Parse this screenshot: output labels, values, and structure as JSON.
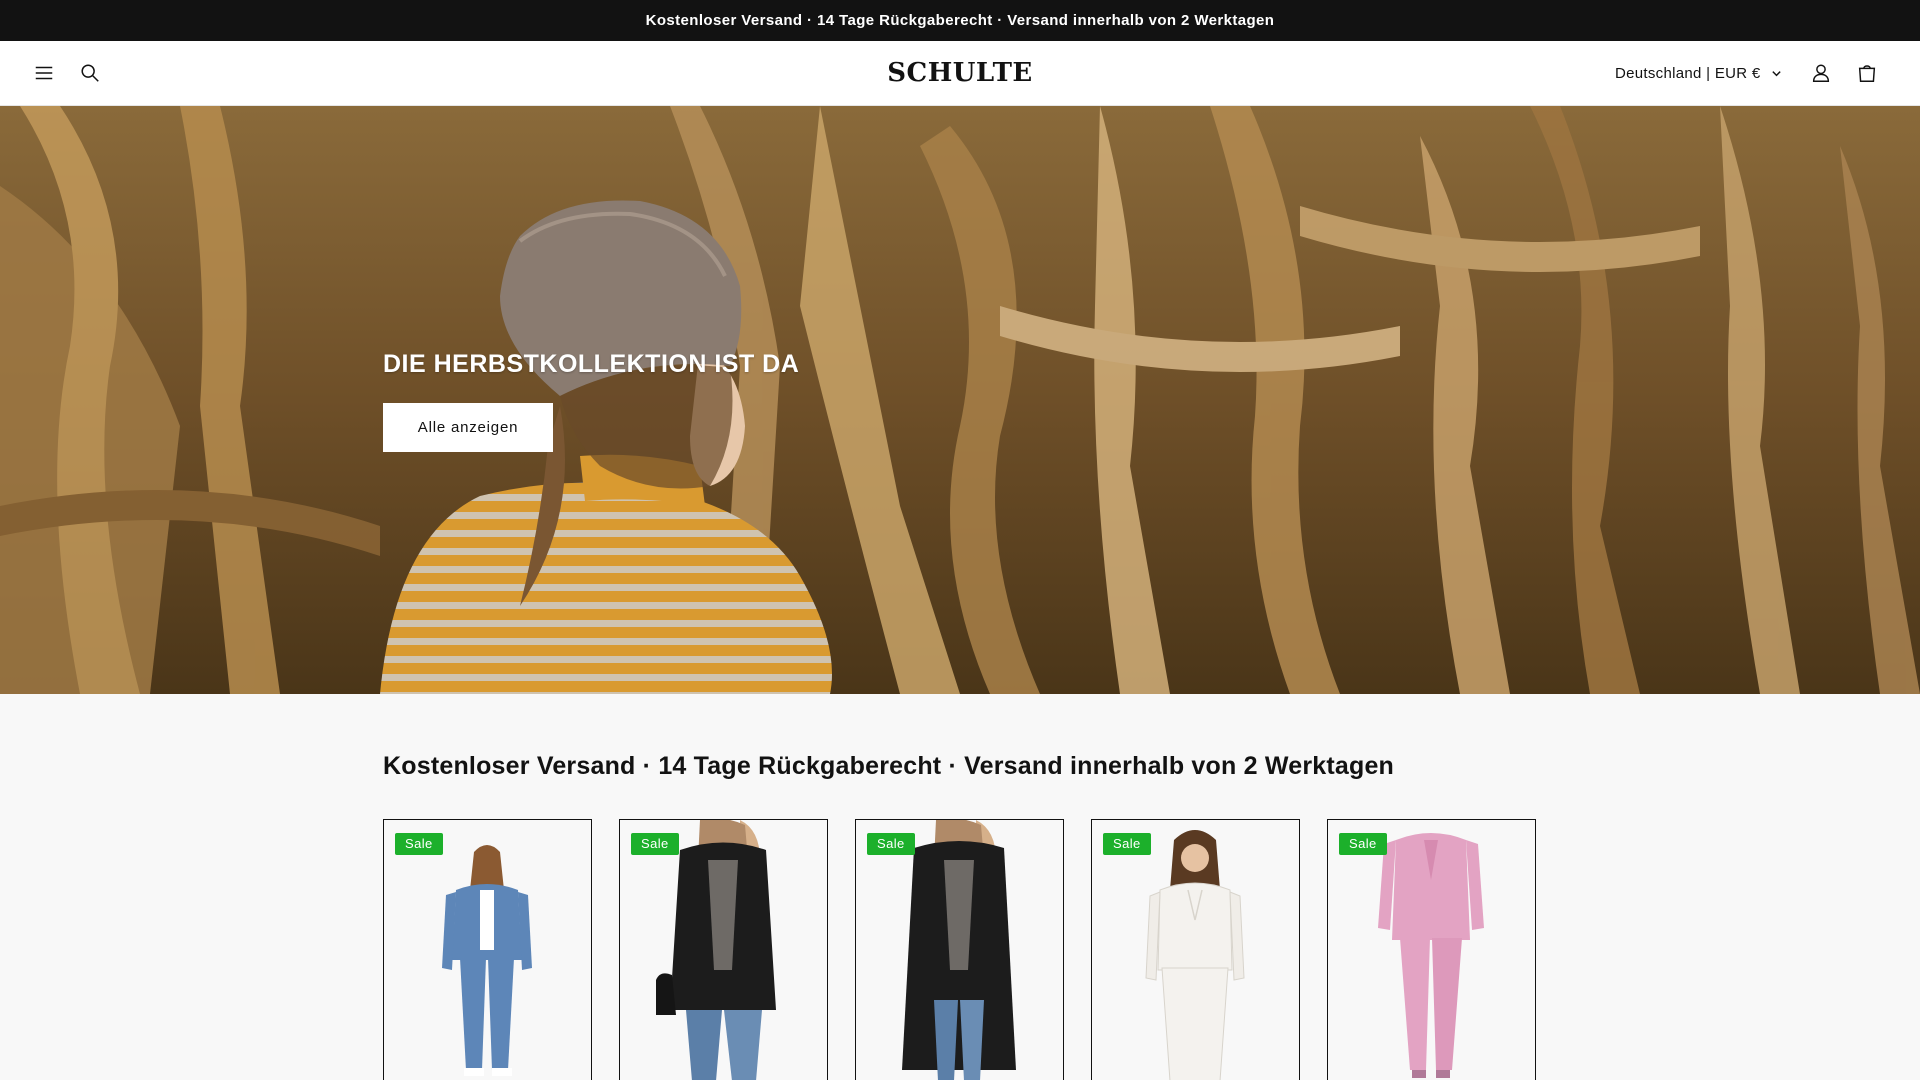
{
  "announcement": {
    "text": "Kostenloser Versand · 14 Tage Rückgaberecht · Versand innerhalb von 2 Werktagen"
  },
  "header": {
    "logo": "SCHULTE",
    "locale": "Deutschland | EUR €",
    "icons": [
      "menu-icon",
      "search-icon",
      "chevron-down-icon",
      "account-icon",
      "cart-icon"
    ]
  },
  "hero": {
    "title": "DIE HERBSTKOLLEKTION IST DA",
    "button_label": "Alle anzeigen"
  },
  "collection": {
    "heading": "Kostenloser Versand · 14 Tage Rückgaberecht · Versand innerhalb von 2 Werktagen",
    "products": [
      {
        "badge": "Sale",
        "color": "#5d86b8"
      },
      {
        "badge": "Sale",
        "color": "#1c1c1c"
      },
      {
        "badge": "Sale",
        "color": "#1c1c1c"
      },
      {
        "badge": "Sale",
        "color": "#f4f2ee"
      },
      {
        "badge": "Sale",
        "color": "#e3a3c3"
      }
    ]
  },
  "colors": {
    "announcement_bg": "#121212",
    "badge": "#1cb02b",
    "page_bg": "#f8f8f8"
  }
}
